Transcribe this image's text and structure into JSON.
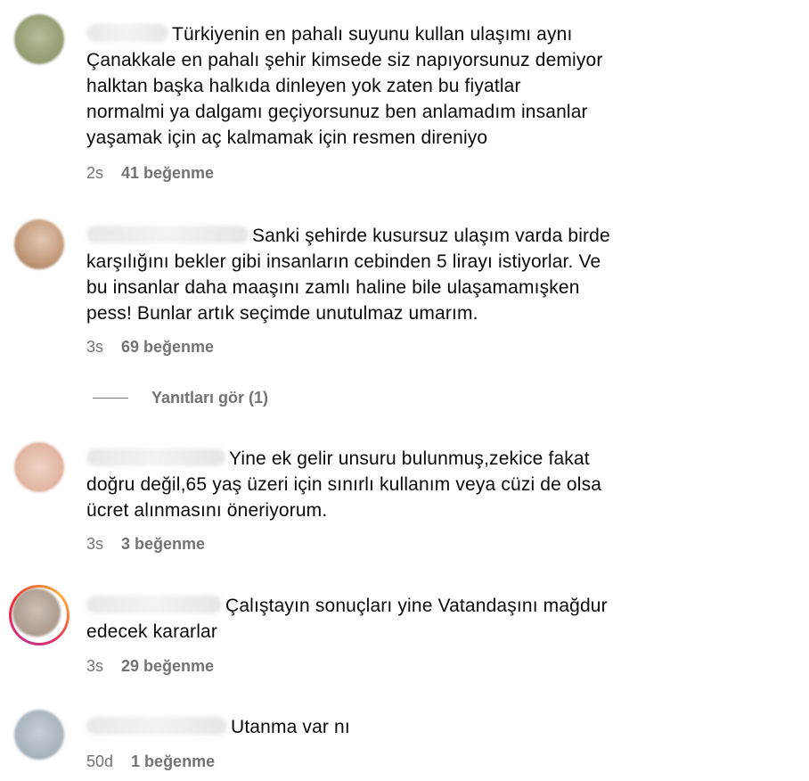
{
  "comments": [
    {
      "text_lines": [
        "Türkiyenin en pahalı suyunu kullan ulaşımı aynı",
        "Çanakkale en pahalı şehir kimsede siz napıyorsunuz demiyor",
        "halktan başka halkıda dinleyen yok zaten bu fiyatlar",
        "normalmi ya dalgamı geçiyorsunuz ben anlamadım insanlar",
        "yaşamak için aç kalmamak için resmen direniyo"
      ],
      "time": "2s",
      "likes": "41 beğenme",
      "avatar_color": "#9aa57f"
    },
    {
      "text_lines": [
        "Sanki şehirde kusursuz ulaşım varda birde",
        "karşılığını bekler gibi insanların cebinden 5 lirayı istiyorlar. Ve",
        "bu insanlar daha maaşını zamlı haline bile ulaşamamışken",
        "pess! Bunlar artık seçimde unutulmaz umarım."
      ],
      "time": "3s",
      "likes": "69 beğenme",
      "replies": "Yanıtları gör (1)",
      "avatar_color": "#c9a58c"
    },
    {
      "text_lines": [
        "Yine ek gelir unsuru bulunmuş,zekice fakat",
        "doğru değil,65 yaş üzeri için sınırlı kullanım veya cüzi de olsa",
        "ücret alınmasını öneriyorum."
      ],
      "time": "3s",
      "likes": "3 beğenme",
      "avatar_color": "#e7c2b2"
    },
    {
      "text_lines": [
        "Çalıştayın sonuçları yine Vatandaşını mağdur",
        "edecek kararlar"
      ],
      "time": "3s",
      "likes": "29 beğenme",
      "avatar_color": "#b9ab9f"
    },
    {
      "text_lines": [
        "Utanma var nı"
      ],
      "time": "50d",
      "likes": "1 beğenme",
      "avatar_color": "#aeb9c3"
    }
  ]
}
